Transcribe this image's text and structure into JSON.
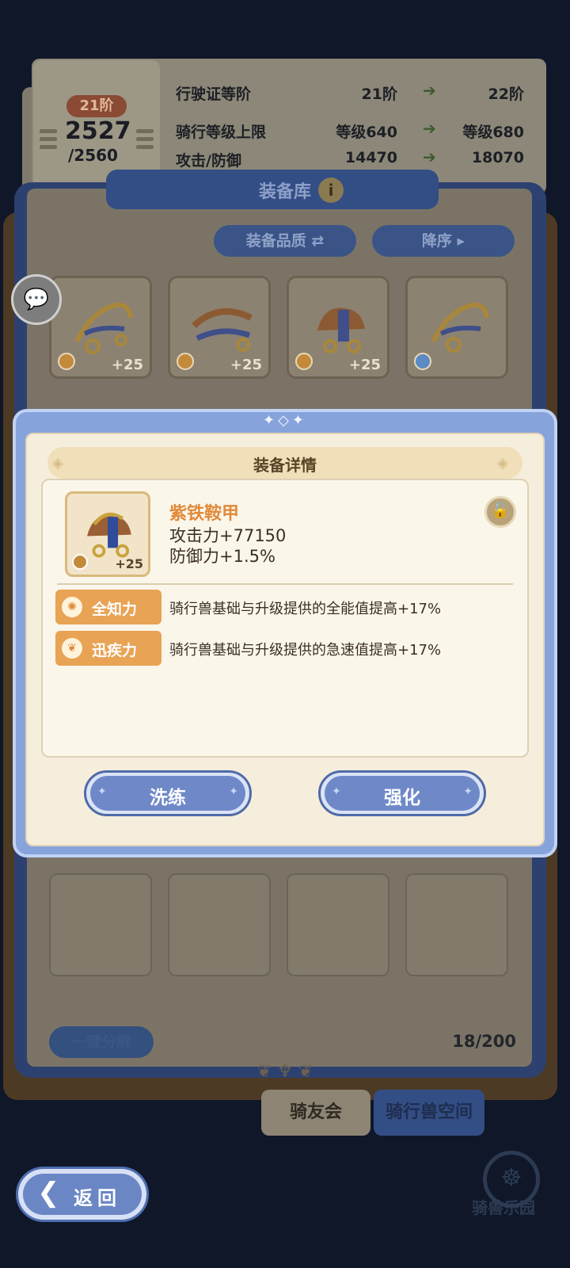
{
  "license": {
    "rank_badge": "21阶",
    "score": "2527",
    "score_max": "/2560",
    "rows": [
      {
        "label": "行驶证等阶",
        "current": "21阶",
        "next": "22阶"
      },
      {
        "label": "骑行等级上限",
        "current": "等级640",
        "next": "等级680"
      },
      {
        "label": "攻击/防御",
        "current": "14470",
        "next": "18070"
      }
    ],
    "arrow": "➔"
  },
  "inventory": {
    "title": "装备库",
    "info_icon": "i",
    "sort_quality": "装备品质 ⇄",
    "sort_order": "降序 ▸",
    "items": [
      {
        "level": "+25",
        "slot_icon": "orange"
      },
      {
        "level": "+25",
        "slot_icon": "orange"
      },
      {
        "level": "+25",
        "slot_icon": "orange"
      },
      {
        "level": "",
        "slot_icon": "blue"
      }
    ],
    "decompose": "一键分解",
    "capacity": "18/200"
  },
  "tabs": {
    "club": "骑友会",
    "space": "骑行兽空间"
  },
  "modal": {
    "title": "装备详情",
    "item_name": "紫铁鞍甲",
    "item_level": "+25",
    "stats": [
      "攻击力+77150",
      "防御力+1.5%"
    ],
    "skills": [
      {
        "name": "全知力",
        "desc": "骑行兽基础与升级提供的全能值提高+17%"
      },
      {
        "name": "迅疾力",
        "desc": "骑行兽基础与升级提供的急速值提高+17%"
      }
    ],
    "btn_reforge": "洗练",
    "btn_enhance": "强化"
  },
  "bottom": {
    "back": "返回",
    "park": "骑兽乐园"
  },
  "colors": {
    "accent_orange": "#e8a354",
    "button_blue": "#6f89c8",
    "item_name": "#e08a3a"
  }
}
